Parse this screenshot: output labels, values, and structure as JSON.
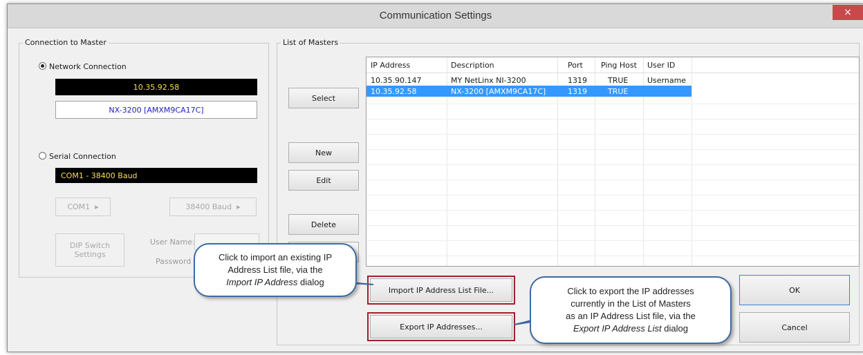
{
  "window": {
    "title": "Communication Settings",
    "close_label": "×"
  },
  "connection": {
    "group_label": "Connection to Master",
    "network_label": "Network Connection",
    "network_ip": "10.35.92.58",
    "network_master": "NX-3200 [AMXM9CA17C]",
    "serial_label": "Serial Connection",
    "serial_value": "COM1 - 38400 Baud",
    "com_button": "COM1",
    "baud_button": "38400 Baud",
    "dip_button_line1": "DIP Switch",
    "dip_button_line2": "Settings",
    "username_label": "User Name:",
    "password_label": "Password"
  },
  "masters": {
    "group_label": "List of Masters",
    "buttons": {
      "select": "Select",
      "new": "New",
      "edit": "Edit",
      "delete": "Delete"
    },
    "columns": [
      "IP Address",
      "Description",
      "Port",
      "Ping Host",
      "User ID"
    ],
    "rows": [
      {
        "ip": "10.35.90.147",
        "description": "MY NetLinx NI-3200",
        "port": "1319",
        "ping": "TRUE",
        "user": "Username",
        "selected": false
      },
      {
        "ip": "10.35.92.58",
        "description": "NX-3200 [AMXM9CA17C]",
        "port": "1319",
        "ping": "TRUE",
        "user": "",
        "selected": true
      }
    ],
    "import_button": "Import IP Address List File...",
    "export_button": "Export IP Addresses..."
  },
  "dialog_buttons": {
    "ok": "OK",
    "cancel": "Cancel"
  },
  "callouts": {
    "import": {
      "line1": "Click to import an existing IP",
      "line2": "Address List file, via the",
      "line3_em": "Import IP Address",
      "line3_rest": " dialog"
    },
    "export": {
      "line1": "Click to export the IP addresses",
      "line2": "currently in the List of Masters",
      "line3": "as an IP Address List file, via the",
      "line4_em": "Export IP Address List",
      "line4_rest": " dialog"
    }
  }
}
